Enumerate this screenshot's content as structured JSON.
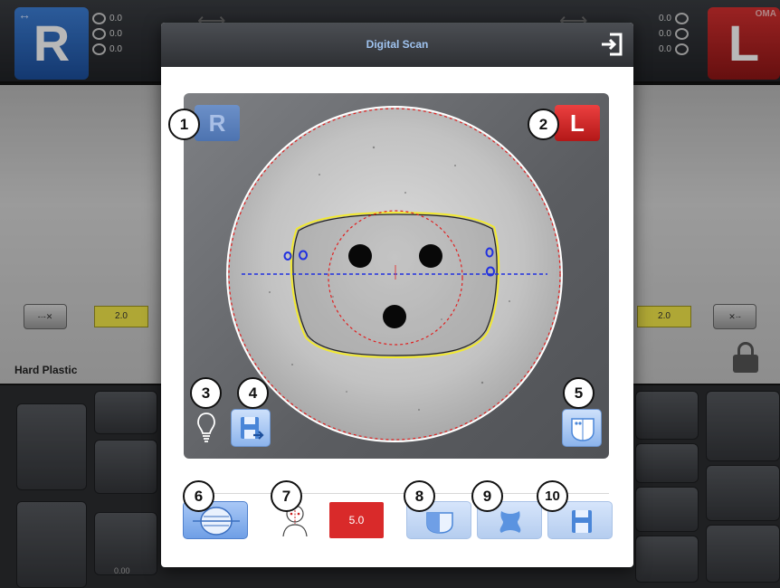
{
  "app": {
    "right_eye": {
      "letter": "R",
      "values": [
        "0.0",
        "0.0",
        "0.0"
      ]
    },
    "left_eye": {
      "letter": "L",
      "tag": "OMA",
      "values": [
        "0.0",
        "0.0",
        "0.0"
      ]
    },
    "material": "Hard Plastic",
    "right_field_value": "2.0",
    "left_field_value": "2.0",
    "bottom_value": "0.00"
  },
  "dialog": {
    "title": "Digital Scan",
    "eye_buttons": {
      "right": "R",
      "left": "L"
    },
    "pd_value": "5.0"
  },
  "badges": [
    "1",
    "2",
    "3",
    "4",
    "5",
    "6",
    "7",
    "8",
    "9",
    "10"
  ],
  "colors": {
    "accent_blue": "#6f9fe6",
    "right_eye_blue": "#2a63b8",
    "left_eye_red": "#d92a2a",
    "frame_outline": "#f2e930",
    "centering_circle": "#e02020",
    "axis_line": "#2030e0"
  },
  "icons": {
    "exit": "exit-icon",
    "light": "lightbulb-icon",
    "save_scan": "save-export-icon",
    "lens_view": "lens-view-icon",
    "centering": "centering-mode-icon",
    "pd": "pupil-distance-icon",
    "shape_edit": "shape-edit-icon",
    "shape_modify": "shape-modify-icon",
    "save": "save-icon"
  }
}
